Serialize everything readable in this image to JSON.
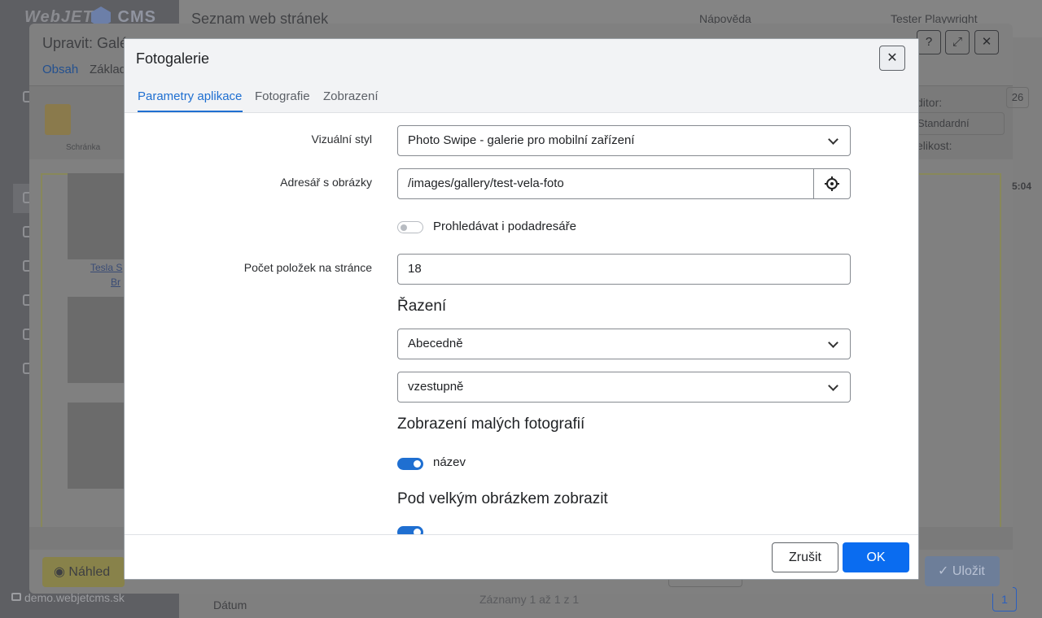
{
  "background": {
    "logo": "WebJET",
    "logo_cms": "CMS",
    "page_title": "Seznam web stránek",
    "help": "Nápověda",
    "user": "Tester Playwright",
    "domain": "demo.webjetcms.sk",
    "folder": "Dátum",
    "records": "Záznamy 1 až 1 z 1",
    "page_number": "1"
  },
  "editor": {
    "title": "Upravit: Galé",
    "tabs": [
      "Obsah",
      "Základ"
    ],
    "clipboard_label": "Schránka",
    "editor_label": "ditor:",
    "editor_value": "Standardní",
    "size_label": "elikost:",
    "counter": "26",
    "time": "5:04",
    "photo_caption_1": "Tesla S",
    "photo_caption_2": "Br",
    "preview_label": "Náhled",
    "save_label": "Uložit"
  },
  "dialog": {
    "title": "Fotogalerie",
    "tabs": [
      "Parametry aplikace",
      "Fotografie",
      "Zobrazení"
    ],
    "active_tab": "Parametry aplikace",
    "fields": {
      "visual_style_label": "Vizuální styl",
      "visual_style_value": "Photo Swipe - galerie pro mobilní zařízení",
      "image_dir_label": "Adresář s obrázky",
      "image_dir_value": "/images/gallery/test-vela-foto",
      "subdirs_label": "Prohledávat i podadresáře",
      "subdirs_on": false,
      "per_page_label": "Počet položek na stránce",
      "per_page_value": "18"
    },
    "sorting": {
      "heading": "Řazení",
      "order_by": "Abecedně",
      "direction": "vzestupně"
    },
    "thumbs": {
      "heading": "Zobrazení malých fotografií",
      "name_label": "název",
      "name_on": true
    },
    "large": {
      "heading": "Pod velkým obrázkem zobrazit"
    },
    "cancel_label": "Zrušit",
    "ok_label": "OK"
  },
  "colors": {
    "accent": "#1f6fd1",
    "ok_button": "#0a6cf0"
  }
}
